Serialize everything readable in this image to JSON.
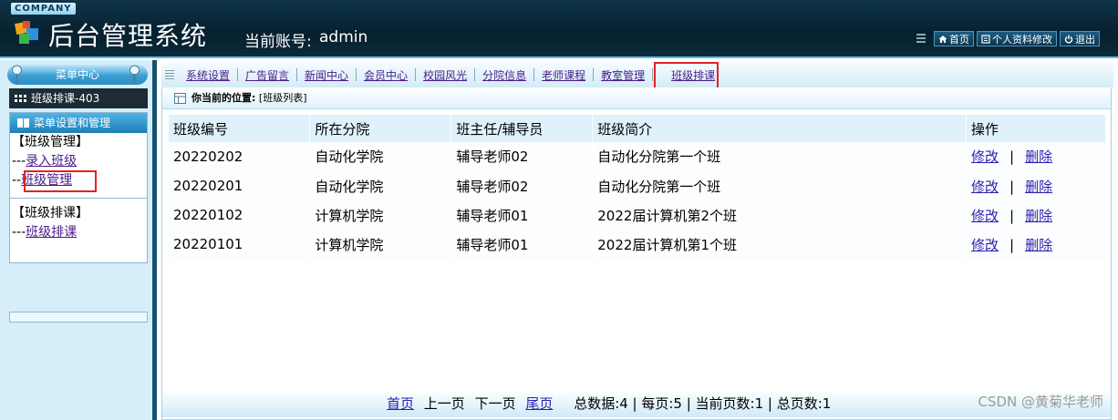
{
  "header": {
    "company": "COMPANY",
    "title": "后台管理系统",
    "account_label": "当前账号:",
    "account_value": "admin",
    "actions": [
      {
        "label": "首页",
        "icon": "home-icon"
      },
      {
        "label": "个人资料修改",
        "icon": "profile-icon"
      },
      {
        "label": "退出",
        "icon": "power-icon"
      }
    ]
  },
  "sidebar": {
    "menu_center": "菜单中心",
    "current": "班级排课-403",
    "panel_title": "菜单设置和管理",
    "groups": [
      {
        "title": "【班级管理】",
        "items": [
          {
            "prefix": "---",
            "label": "录入班级"
          },
          {
            "prefix": "--",
            "label": "班级管理"
          }
        ]
      },
      {
        "title": "【班级排课】",
        "items": [
          {
            "prefix": "---",
            "label": "班级排课"
          }
        ]
      }
    ]
  },
  "nav": [
    "系统设置",
    "广告留言",
    "新闻中心",
    "会员中心",
    "校园风光",
    "分院信息",
    "老师课程",
    "教室管理",
    "班级排课"
  ],
  "breadcrumb": {
    "label": "你当前的位置:",
    "value": "[班级列表]"
  },
  "table": {
    "headers": [
      "班级编号",
      "所在分院",
      "班主任/辅导员",
      "班级简介",
      "操作"
    ],
    "rows": [
      [
        "20220202",
        "自动化学院",
        "辅导老师02",
        "自动化分院第一个班"
      ],
      [
        "20220201",
        "自动化学院",
        "辅导老师02",
        "自动化分院第一个班"
      ],
      [
        "20220102",
        "计算机学院",
        "辅导老师01",
        "2022届计算机第2个班"
      ],
      [
        "20220101",
        "计算机学院",
        "辅导老师01",
        "2022届计算机第1个班"
      ]
    ],
    "edit_label": "修改",
    "delete_label": "删除",
    "op_separator": "|"
  },
  "pager": {
    "first": "首页",
    "prev": "上一页",
    "next": "下一页",
    "last": "尾页",
    "summary": "总数据:4 | 每页:5 | 当前页数:1 | 总页数:1"
  },
  "watermark": "CSDN @黄菊华老师",
  "colors": {
    "highlight": "#e02424",
    "header_bg": "#06202e",
    "accent": "#2b8cc2"
  }
}
